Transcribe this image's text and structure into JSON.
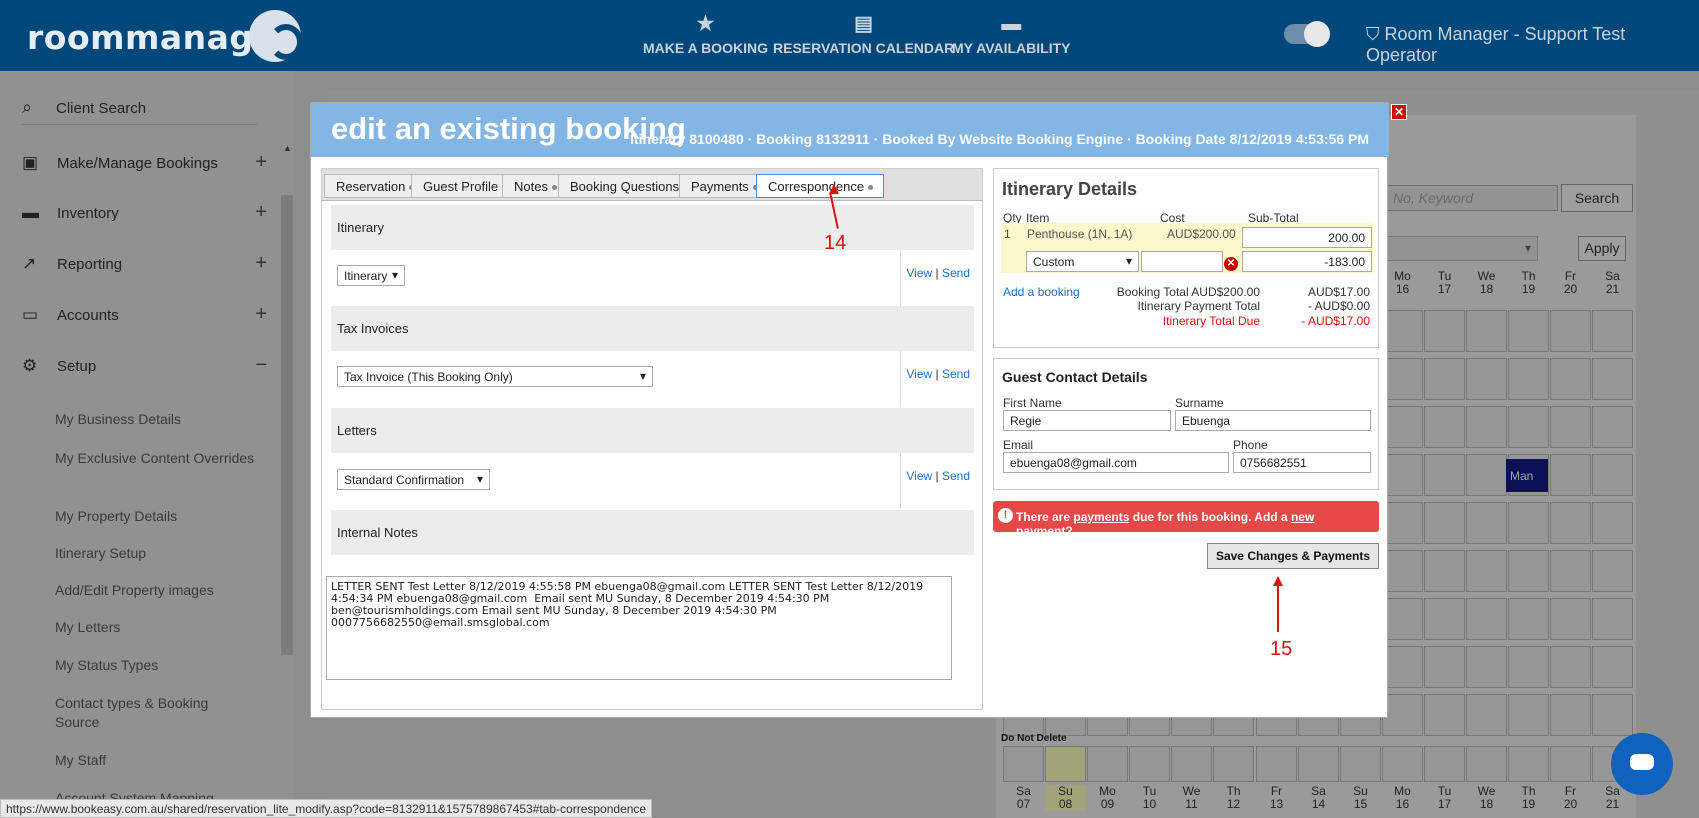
{
  "topbar": {
    "logo": "roommanager",
    "nav": [
      {
        "label": "MAKE A BOOKING",
        "icon": "star-icon"
      },
      {
        "label": "RESERVATION CALENDAR",
        "icon": "calendar-icon"
      },
      {
        "label": "MY AVAILABILITY",
        "icon": "bed-icon"
      }
    ],
    "user_label": "Room Manager - Support Test Operator"
  },
  "sidebar": {
    "search": "Client Search",
    "items": [
      {
        "label": "Make/Manage Bookings",
        "icon": "calendar-check-icon",
        "toggle": "+"
      },
      {
        "label": "Inventory",
        "icon": "bed-icon",
        "toggle": "+"
      },
      {
        "label": "Reporting",
        "icon": "trending-up-icon",
        "toggle": "+"
      },
      {
        "label": "Accounts",
        "icon": "card-icon",
        "toggle": "+"
      },
      {
        "label": "Setup",
        "icon": "gear-icon",
        "toggle": "−"
      }
    ],
    "subitems": [
      "My Business Details",
      "My Exclusive Content Overrides",
      "My Property Details",
      "Itinerary Setup",
      "Add/Edit Property images",
      "My Letters",
      "My Status Types",
      "Contact types & Booking Source",
      "My Staff",
      "Account System Mapping"
    ]
  },
  "background": {
    "search_placeholder": "No, Keyword",
    "search_button": "Search",
    "apply_button": "Apply",
    "top_days": [
      [
        "Mo",
        "16"
      ],
      [
        "Tu",
        "17"
      ],
      [
        "We",
        "18"
      ],
      [
        "Th",
        "19"
      ],
      [
        "Fr",
        "20"
      ],
      [
        "Sa",
        "21"
      ]
    ],
    "bottom_days": [
      [
        "Sa",
        "07"
      ],
      [
        "Su",
        "08"
      ],
      [
        "Mo",
        "09"
      ],
      [
        "Tu",
        "10"
      ],
      [
        "We",
        "11"
      ],
      [
        "Th",
        "12"
      ],
      [
        "Fr",
        "13"
      ],
      [
        "Sa",
        "14"
      ],
      [
        "Su",
        "15"
      ],
      [
        "Mo",
        "16"
      ],
      [
        "Tu",
        "17"
      ],
      [
        "We",
        "18"
      ],
      [
        "Th",
        "19"
      ],
      [
        "Fr",
        "20"
      ],
      [
        "Sa",
        "21"
      ]
    ],
    "man_label": "Man",
    "do_not_delete": "Do Not Delete"
  },
  "modal": {
    "title": "edit an existing booking",
    "subtitle": "Itinerary 8100480 · Booking 8132911 · Booked By Website Booking Engine · Booking Date 8/12/2019 4:53:56 PM",
    "close": "✕",
    "tabs": [
      "Reservation",
      "Guest Profile",
      "Notes",
      "Booking Questions",
      "Payments",
      "Correspondence"
    ],
    "sections": {
      "itinerary": {
        "heading": "Itinerary",
        "select": "Itinerary"
      },
      "tax": {
        "heading": "Tax Invoices",
        "select": "Tax Invoice (This Booking Only)"
      },
      "letters": {
        "heading": "Letters",
        "select": "Standard Confirmation"
      },
      "internal": {
        "heading": "Internal Notes"
      }
    },
    "view": "View",
    "send": "Send",
    "notes_text": "LETTER SENT Test Letter 8/12/2019 4:55:58 PM ebuenga08@gmail.com LETTER SENT Test Letter 8/12/2019\n4:54:34 PM ebuenga08@gmail.com  Email sent MU Sunday, 8 December 2019 4:54:30 PM\nben@tourismholdings.com Email sent MU Sunday, 8 December 2019 4:54:30 PM\n0007756682550@email.smsglobal.com",
    "itinerary_details": {
      "title": "Itinerary Details",
      "headers": {
        "qty": "Qty",
        "item": "Item",
        "cost": "Cost",
        "subtotal": "Sub-Total"
      },
      "row_qty": "1",
      "row_item": "Penthouse (1N, 1A)",
      "row_cost": "AUD$200.00",
      "row_subtotal": "200.00",
      "custom_select": "Custom",
      "custom_subtotal": "-183.00",
      "add_booking": "Add a booking",
      "booking_total_label": "Booking Total AUD$200.00",
      "booking_total_value": "AUD$17.00",
      "payment_total_label": "Itinerary Payment Total",
      "payment_total_value": "-   AUD$0.00",
      "total_due_label": "Itinerary Total Due",
      "total_due_value": "-  AUD$17.00"
    },
    "guest_contact": {
      "title": "Guest Contact Details",
      "first_name_label": "First Name",
      "first_name": "Regie",
      "surname_label": "Surname",
      "surname": "Ebuenga",
      "email_label": "Email",
      "email": "ebuenga08@gmail.com",
      "phone_label": "Phone",
      "phone": "0756682551"
    },
    "alert": {
      "pre": "There are ",
      "link1": "payments",
      "mid": " due for this booking. Add a ",
      "link2": "new payment",
      "post": "?"
    },
    "save_button": "Save Changes & Payments"
  },
  "annotations": {
    "a14": "14",
    "a15": "15"
  },
  "statusbar": "https://www.bookeasy.com.au/shared/reservation_lite_modify.asp?code=8132911&1575789867453#tab-correspondence",
  "colors": {
    "topbar": "#00487b",
    "modal_header": "#83b5e5",
    "alert": "#e64848",
    "annotation": "#e01010"
  }
}
